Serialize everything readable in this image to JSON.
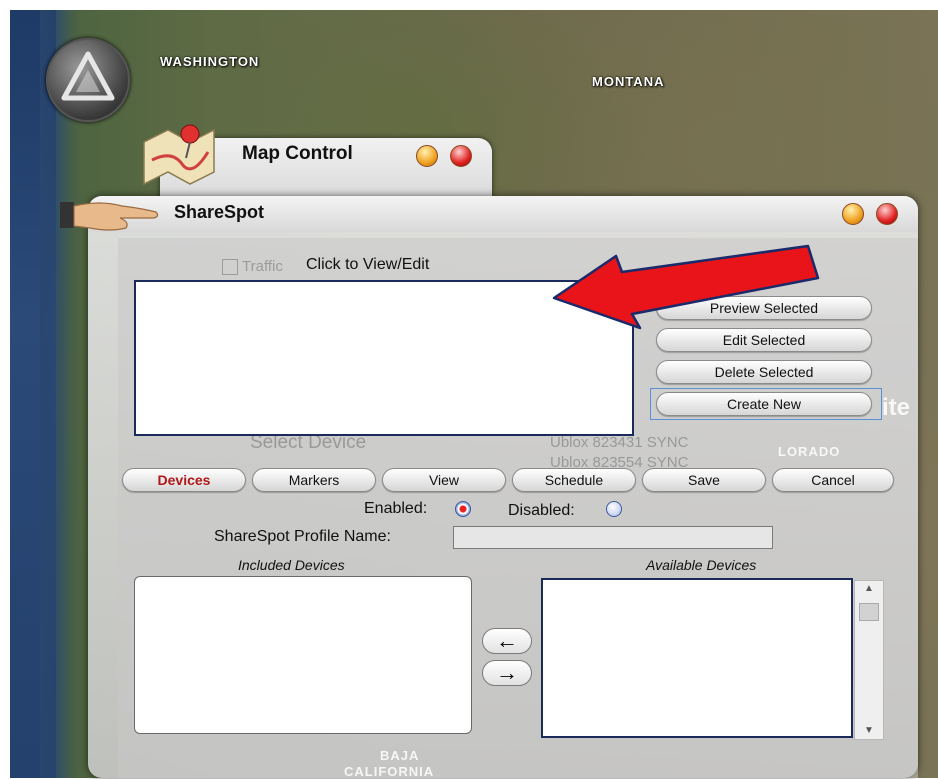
{
  "map": {
    "labels": {
      "washington": "WASHINGTON",
      "montana": "MONTANA",
      "baja": "BAJA",
      "california": "CALIFORNIA",
      "colorado_fragment": "LORADO",
      "overflow_text": "ite"
    }
  },
  "map_control": {
    "title": "Map Control",
    "ghost_traffic": "Traffic",
    "ghost_select_device": "Select Device",
    "ghost_device_1": "Ublox 823431 SYNC",
    "ghost_device_2": "Ublox 823554 SYNC"
  },
  "sharespot": {
    "title": "ShareSpot",
    "list_caption": "Click to View/Edit",
    "buttons": {
      "preview": "Preview Selected",
      "edit": "Edit Selected",
      "delete": "Delete Selected",
      "create": "Create New"
    },
    "tabs": [
      {
        "label": "Devices",
        "active": true
      },
      {
        "label": "Markers",
        "active": false
      },
      {
        "label": "View",
        "active": false
      },
      {
        "label": "Schedule",
        "active": false
      },
      {
        "label": "Save",
        "active": false
      },
      {
        "label": "Cancel",
        "active": false
      }
    ],
    "enabled_label": "Enabled:",
    "disabled_label": "Disabled:",
    "enabled_selected": true,
    "profile_label": "ShareSpot Profile Name:",
    "profile_value": "",
    "included_caption": "Included Devices",
    "available_caption": "Available Devices",
    "move_left": "←",
    "move_right": "→"
  },
  "colors": {
    "annotation_arrow": "#e8141a",
    "active_tab_text": "#b01818",
    "list_border": "#1a2a5a"
  }
}
